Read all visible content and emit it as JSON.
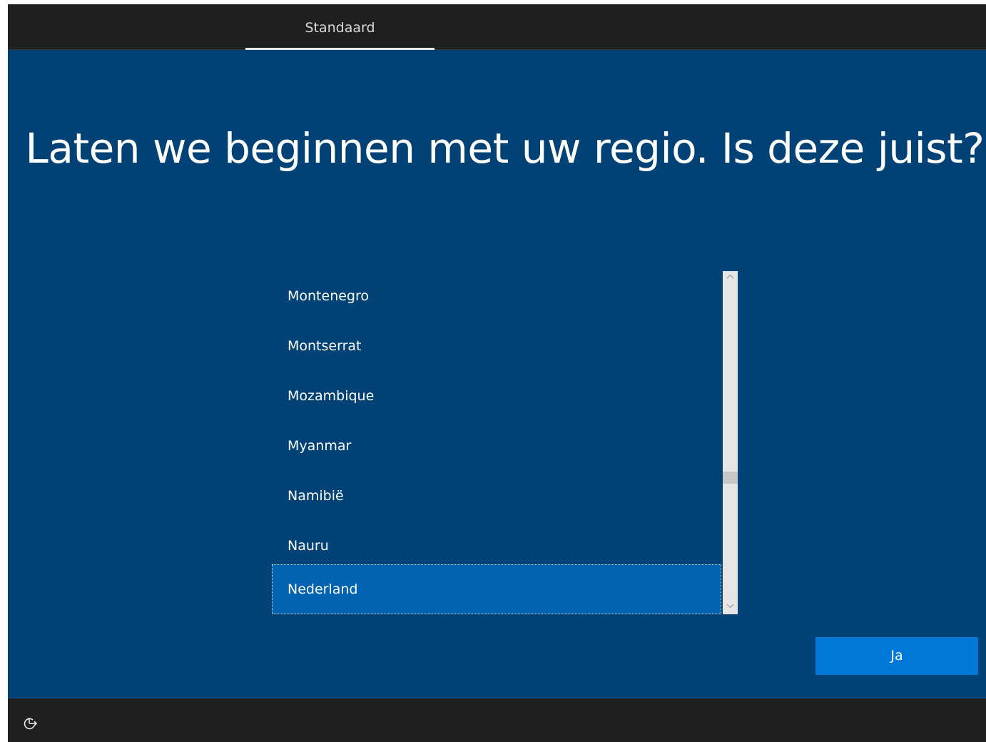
{
  "header": {
    "tab_label": "Standaard"
  },
  "main": {
    "title": "Laten we beginnen met uw regio. Is deze juist?"
  },
  "region_list": {
    "items": [
      {
        "label": "Montenegro"
      },
      {
        "label": "Montserrat"
      },
      {
        "label": "Mozambique"
      },
      {
        "label": "Myanmar"
      },
      {
        "label": "Namibië"
      },
      {
        "label": "Nauru"
      },
      {
        "label": "Nederland"
      }
    ],
    "selected_index": 6
  },
  "actions": {
    "confirm_label": "Ja"
  },
  "footer": {
    "accessibility_icon": "ease-of-access-icon"
  },
  "colors": {
    "background": "#004275",
    "bar": "#1f1f1f",
    "selected_item": "#0063b1",
    "accent_button": "#0078d7"
  }
}
